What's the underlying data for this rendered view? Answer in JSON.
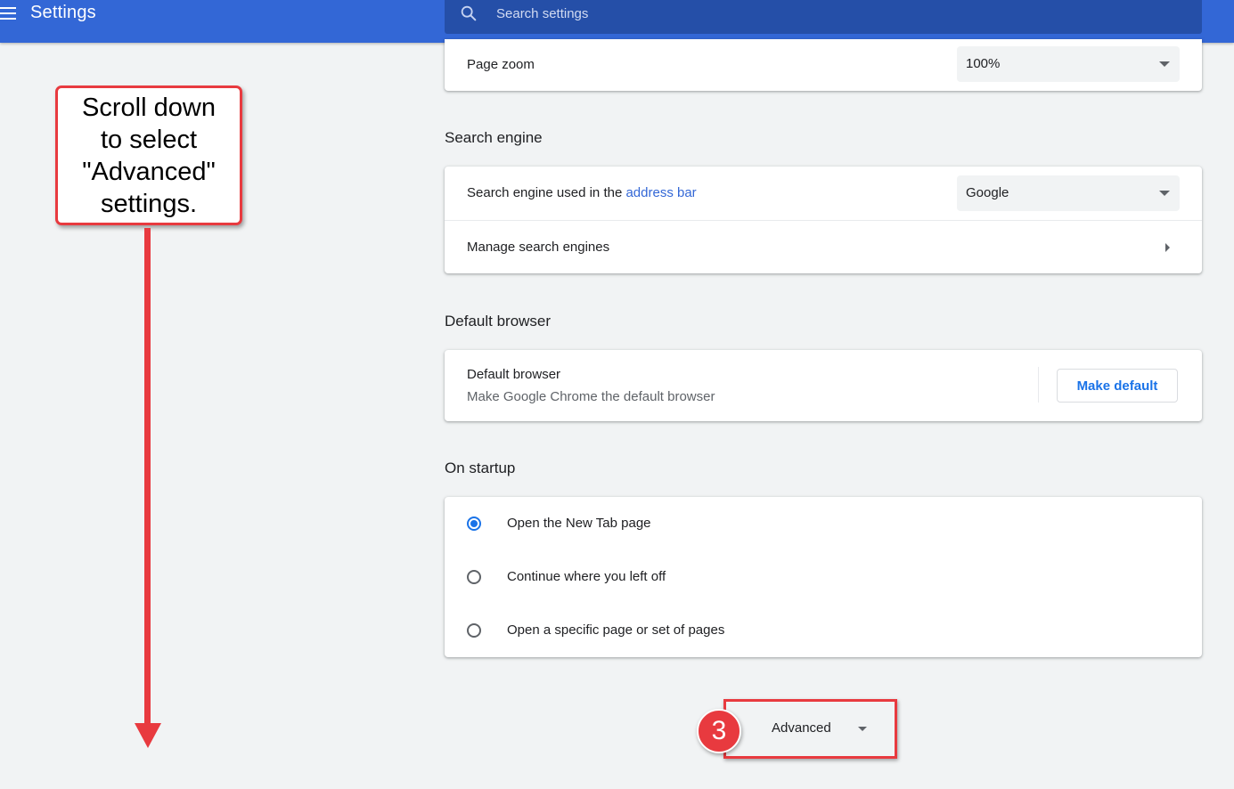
{
  "header": {
    "title": "Settings",
    "search": {
      "placeholder": "Search settings"
    }
  },
  "appearance": {
    "page_zoom_label": "Page zoom",
    "page_zoom_value": "100%"
  },
  "search_engine": {
    "section_title": "Search engine",
    "used_in_prefix": "Search engine used in the ",
    "used_in_link": "address bar",
    "engine_value": "Google",
    "manage_label": "Manage search engines"
  },
  "default_browser": {
    "section_title": "Default browser",
    "row_title": "Default browser",
    "row_subtitle": "Make Google Chrome the default browser",
    "button_label": "Make default"
  },
  "on_startup": {
    "section_title": "On startup",
    "options": [
      {
        "label": "Open the New Tab page",
        "selected": true
      },
      {
        "label": "Continue where you left off",
        "selected": false
      },
      {
        "label": "Open a specific page or set of pages",
        "selected": false
      }
    ]
  },
  "advanced": {
    "label": "Advanced"
  },
  "annotations": {
    "callout_lines": [
      "Scroll down",
      "to select",
      "\"Advanced\"",
      "settings."
    ],
    "step_number": "3",
    "accent_color": "#e83a3f"
  },
  "colors": {
    "header_bg": "#3367d6",
    "search_bg": "#254fa8",
    "link": "#3367d6",
    "button_text": "#1a73e8",
    "page_bg": "#f1f3f4"
  }
}
